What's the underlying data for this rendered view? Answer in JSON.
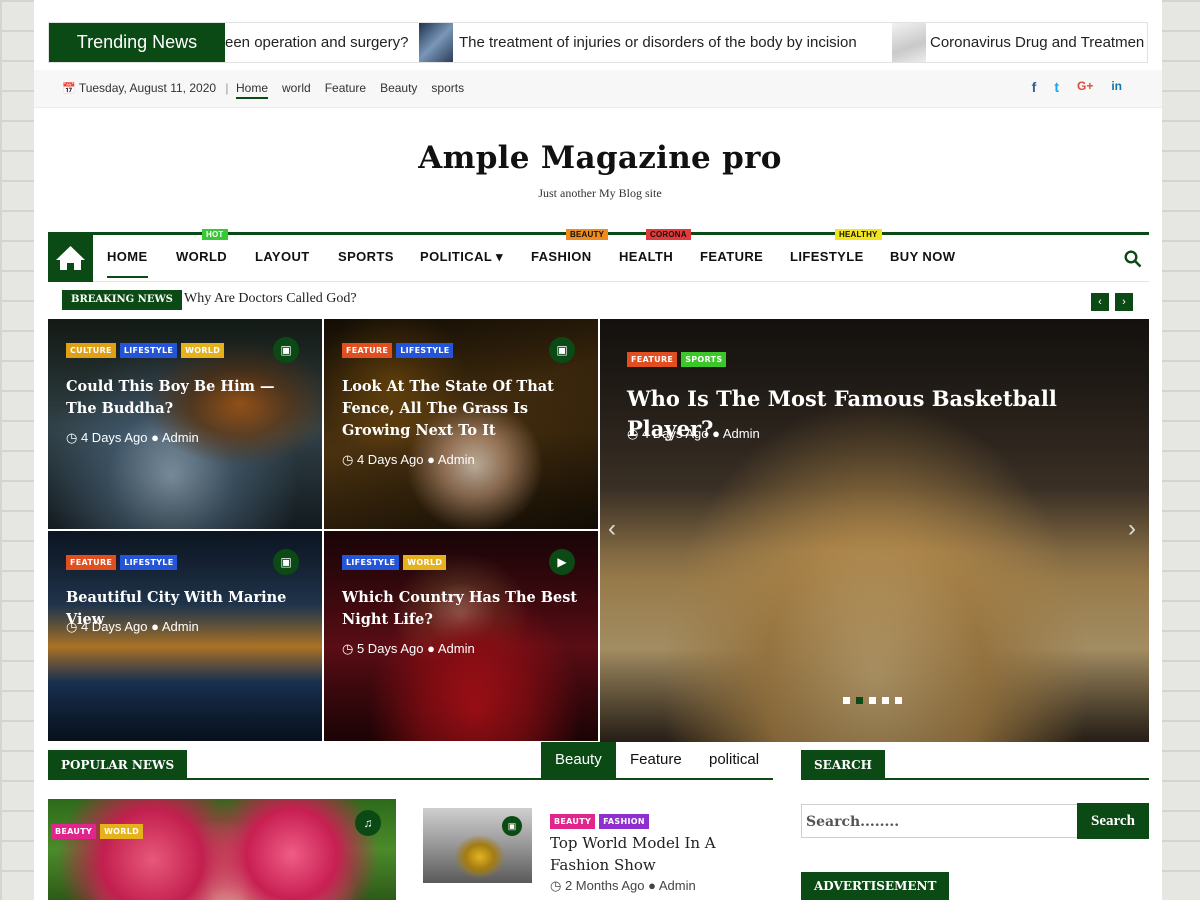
{
  "trending": {
    "label": "Trending News",
    "items": [
      "een operation and surgery?",
      "The treatment of injuries or disorders of the body by incision",
      "Coronavirus Drug and Treatmen"
    ]
  },
  "topbar": {
    "date": "Tuesday, August 11, 2020",
    "separator": "|",
    "links": [
      "Home",
      "world",
      "Feature",
      "Beauty",
      "sports"
    ],
    "social": [
      "f",
      "t",
      "G+",
      "in"
    ]
  },
  "brand": {
    "title": "Ample Magazine pro",
    "tagline": "Just another My Blog site"
  },
  "nav": {
    "items": [
      "HOME",
      "WORLD",
      "LAYOUT",
      "SPORTS",
      "POLITICAL",
      "FASHION",
      "HEALTH",
      "FEATURE",
      "LIFESTYLE",
      "BUY NOW"
    ],
    "badges": {
      "hot": "HOT",
      "beauty": "BEAUTY",
      "corona": "CORONA",
      "healthy": "HEALTHY"
    },
    "dropdown_arrow": "▾"
  },
  "breaking": {
    "label": "BREAKING NEWS",
    "text": "Why Are Doctors Called God?",
    "prev": "‹",
    "next": "›"
  },
  "cards": [
    {
      "tags": [
        "CULTURE",
        "LIFESTYLE",
        "WORLD"
      ],
      "title": "Could This Boy Be Him — The Buddha?",
      "time": "4 Days Ago",
      "author": "Admin",
      "media_icon": "image-icon"
    },
    {
      "tags": [
        "FEATURE",
        "LIFESTYLE"
      ],
      "title": "Look At The State Of That Fence, All The Grass Is Growing Next To It",
      "time": "4 Days Ago",
      "author": "Admin",
      "media_icon": "image-icon"
    },
    {
      "tags": [
        "FEATURE",
        "LIFESTYLE"
      ],
      "title": "Beautiful City With Marine View",
      "time": "4 Days Ago",
      "author": "Admin",
      "media_icon": "image-icon"
    },
    {
      "tags": [
        "LIFESTYLE",
        "WORLD"
      ],
      "title": "Which Country Has The Best Night Life?",
      "time": "5 Days Ago",
      "author": "Admin",
      "media_icon": "video-icon"
    }
  ],
  "slider": {
    "tags": [
      "FEATURE",
      "SPORTS"
    ],
    "title": "Who Is The Most Famous Basketball Player?",
    "time": "4 Days Ago",
    "author": "Admin",
    "prev": "‹",
    "next": "›",
    "dot_count": 5,
    "active_dot": 2
  },
  "popular": {
    "heading": "POPULAR NEWS",
    "tabs": [
      "Beauty",
      "Feature",
      "political"
    ],
    "big": {
      "tags": [
        "BEAUTY",
        "WORLD"
      ],
      "media_icon": "audio-icon"
    },
    "item": {
      "tags": [
        "BEAUTY",
        "FASHION"
      ],
      "title": "Top World Model In A Fashion Show",
      "time": "2 Months Ago",
      "author": "Admin"
    }
  },
  "sidebar": {
    "search_heading": "SEARCH",
    "search_placeholder": "Search........",
    "search_button": "Search",
    "ad_heading": "ADVERTISEMENT"
  },
  "colors": {
    "primary": "#0b4a15",
    "tag_culture": "#e0a016",
    "tag_lifestyle": "#2455d8",
    "tag_world": "#e5b21b",
    "tag_feature": "#e14e1f",
    "tag_sports": "#3bc629",
    "tag_beauty": "#e0268d",
    "tag_fashion": "#8e2fd0"
  }
}
